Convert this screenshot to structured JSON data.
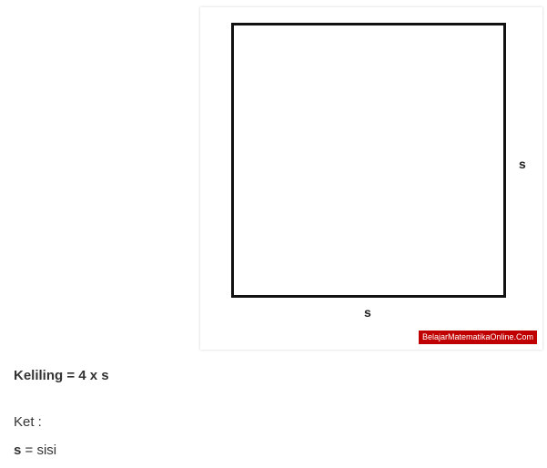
{
  "figure": {
    "bottom_side_label": "s",
    "right_side_label": "s",
    "watermark": "BelajarMatematikaOnline.Com"
  },
  "text": {
    "formula": "Keliling = 4 x s",
    "ket_label": "Ket :",
    "definition_term": "s",
    "definition_rest": " = sisi"
  }
}
